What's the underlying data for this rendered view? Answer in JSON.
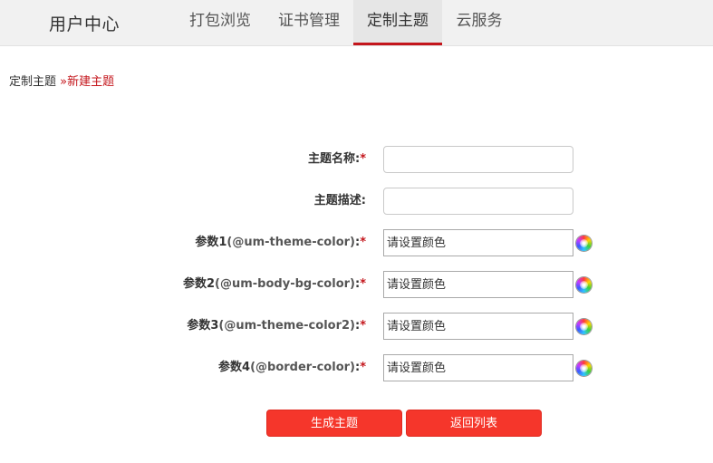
{
  "header": {
    "brand": "用户中心",
    "tabs": [
      {
        "label": "打包浏览",
        "active": false
      },
      {
        "label": "证书管理",
        "active": false
      },
      {
        "label": "定制主题",
        "active": true
      },
      {
        "label": "云服务",
        "active": false
      }
    ],
    "accent_color": "#c4161c"
  },
  "breadcrumb": {
    "parent": "定制主题",
    "separator": "»",
    "current": "新建主题"
  },
  "form": {
    "name": {
      "label": "主题名称:",
      "required_mark": "*",
      "value": ""
    },
    "description": {
      "label": "主题描述:",
      "value": ""
    },
    "params": [
      {
        "label_prefix": "参数1",
        "param": "(@um-theme-color)",
        "suffix": ":",
        "required_mark": "*",
        "placeholder": "请设置颜色",
        "icon": "color-picker-icon"
      },
      {
        "label_prefix": "参数2",
        "param": "(@um-body-bg-color)",
        "suffix": ":",
        "required_mark": "*",
        "placeholder": "请设置颜色",
        "icon": "color-picker-icon"
      },
      {
        "label_prefix": "参数3",
        "param": "(@um-theme-color2)",
        "suffix": ":",
        "required_mark": "*",
        "placeholder": "请设置颜色",
        "icon": "color-picker-icon"
      },
      {
        "label_prefix": "参数4",
        "param": "(@border-color)",
        "suffix": ":",
        "required_mark": "*",
        "placeholder": "请设置颜色",
        "icon": "color-picker-icon"
      }
    ]
  },
  "actions": {
    "generate": "生成主题",
    "back": "返回列表",
    "button_color": "#f5362b"
  }
}
